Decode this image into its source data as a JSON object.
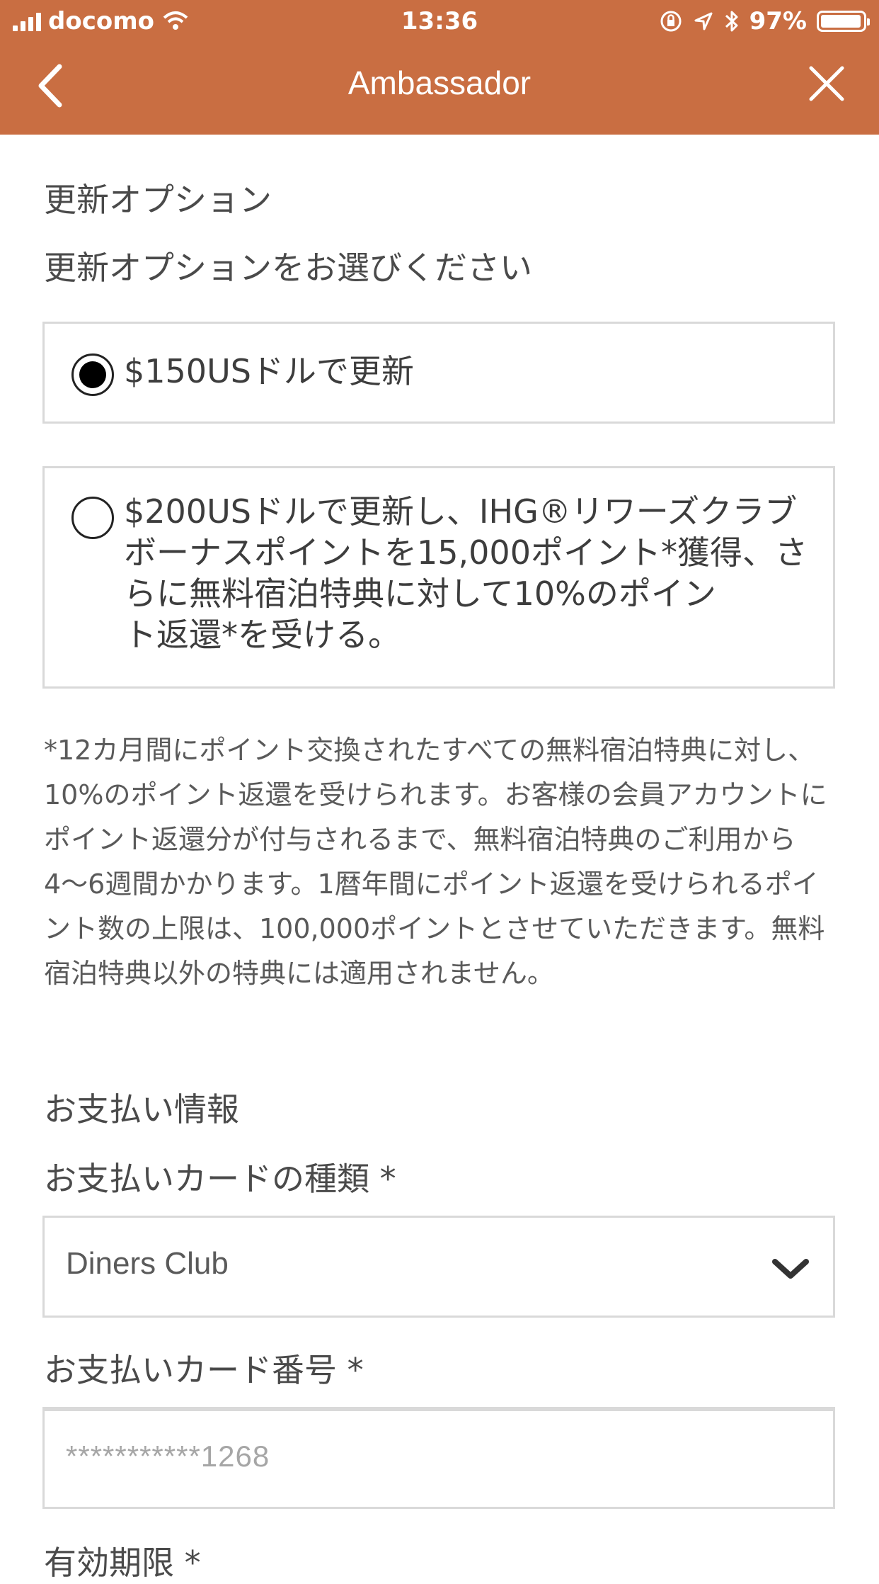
{
  "status_bar": {
    "carrier": "docomo",
    "time": "13:36",
    "battery": "97%",
    "battery_level": 0.97
  },
  "nav": {
    "title": "Ambassador",
    "back_icon": "chevron-left-icon",
    "close_icon": "close-icon"
  },
  "renewal": {
    "heading": "更新オプション",
    "subheading": "更新オプションをお選びください",
    "options": [
      {
        "selected": true,
        "label": "$150USドルで更新"
      },
      {
        "selected": false,
        "label_lines": [
          "$200USドルで更新し、IHG®リワーズクラブ",
          "ボーナスポイントを15,000ポイント*獲得、さ",
          "らに無料宿泊特典に対して10%のポイン",
          "ト返還*を受ける。"
        ]
      }
    ],
    "note": "*12カ月間にポイント交換されたすべての無料宿泊特典に対し、10%のポイント返還を受けられます。お客様の会員アカウントにポイント返還分が付与されるまで、無料宿泊特典のご利用から4〜6週間かかります。1暦年間にポイント返還を受けられるポイント数の上限は、100,000ポイントとさせていただきます。無料宿泊特典以外の特典には適用されません。"
  },
  "payment": {
    "heading": "お支払い情報",
    "card_type_label": "お支払いカードの種類 *",
    "card_type_value": "Diners Club",
    "card_number_label": "お支払いカード番号 *",
    "card_number_value": "***********1268",
    "expiry_label": "有効期限 *"
  },
  "colors": {
    "header": "#c96e42",
    "text": "#4a4a4a",
    "border": "#d9d9d9"
  }
}
